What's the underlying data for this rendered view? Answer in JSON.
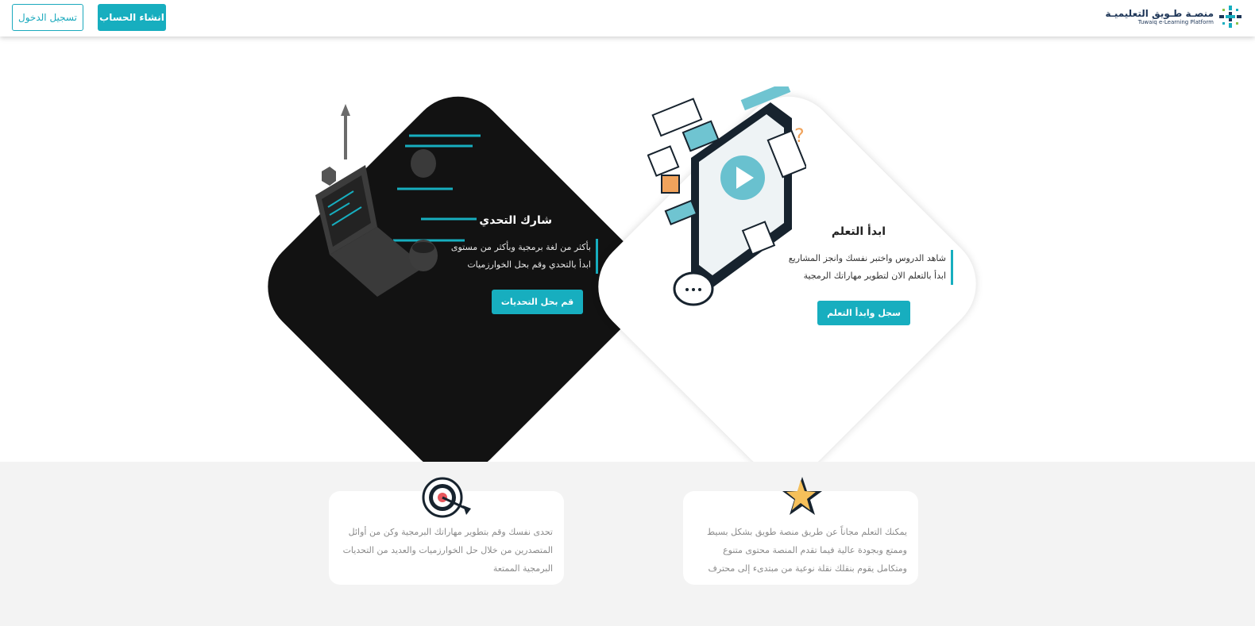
{
  "header": {
    "login_label": "تسجيل الدخول",
    "signup_label": "انشاء الحساب",
    "logo_ar": "منصـة طـويق التعليميـة",
    "logo_en": "Tuwaiq e-Learning Platform"
  },
  "cards": {
    "challenge": {
      "title": "شارك التحدي",
      "line1": "بأكثر من لغة برمجية وبأكثر من مستوى",
      "line2": "ابدأ بالتحدي وقم بحل الخوارزميات",
      "button": "قم بحل التحديات"
    },
    "learn": {
      "title": "ابدأ التعلم",
      "line1": "شاهد الدروس واختبر نفسك وانجز المشاريع",
      "line2": "ابدأ بالتعلم الان لتطوير مهاراتك الرمجية",
      "button": "سجل وابدأ التعلم"
    }
  },
  "features": {
    "left": {
      "text": "تحدى نفسك وقم بتطوير مهاراتك البرمجية وكن من أوائل المتصدرين من خلال حل الخوارزميات والعديد من التحديات البرمجية الممتعة",
      "icon": "target-icon"
    },
    "right": {
      "text": "يمكنك التعلم مجاناً عن طريق منصة طويق بشكل بسيط وممتع وبجودة عالية فيما تقدم المنصة محتوى متنوع ومتكامل يقوم بنقلك نقلة نوعية من مبتدىء إلى محترف",
      "icon": "star-icon"
    }
  },
  "colors": {
    "accent": "#17aebf",
    "dark_card": "#121212",
    "bottom_bg": "#f3f3f3"
  }
}
